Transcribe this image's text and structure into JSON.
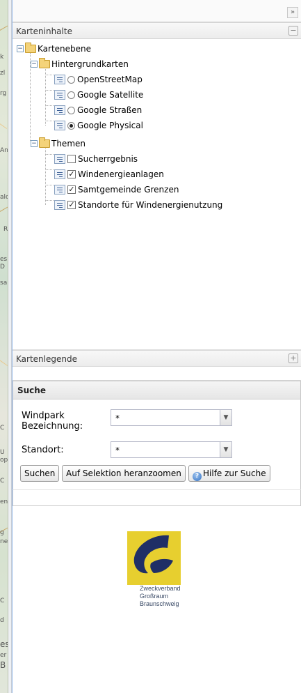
{
  "map_labels": [
    "k",
    "zl",
    "rg",
    "An",
    "alc",
    "R",
    "es",
    "D",
    "sa",
    "C",
    "U",
    "op",
    "C",
    "en",
    "g",
    "ne",
    "C",
    "d",
    "es",
    "er",
    "B"
  ],
  "topbar": {
    "collapse_glyph": "»"
  },
  "layers_panel": {
    "title": "Karteninhalte",
    "collapse_glyph": "−",
    "tree": {
      "root": "Kartenebene",
      "basemaps_group": "Hintergrundkarten",
      "basemaps": [
        {
          "label": "OpenStreetMap",
          "selected": false
        },
        {
          "label": "Google Satellite",
          "selected": false
        },
        {
          "label": "Google Straßen",
          "selected": false
        },
        {
          "label": "Google Physical",
          "selected": true
        }
      ],
      "themes_group": "Themen",
      "themes": [
        {
          "label": "Sucherrgebnis",
          "checked": false
        },
        {
          "label": "Windenergieanlagen",
          "checked": true
        },
        {
          "label": "Samtgemeinde Grenzen",
          "checked": true
        },
        {
          "label": "Standorte für Windenergienutzung",
          "checked": true
        }
      ]
    }
  },
  "legend_panel": {
    "title": "Kartenlegende",
    "expand_glyph": "+"
  },
  "search": {
    "title": "Suche",
    "windpark_label": "Windpark Bezeichnung:",
    "windpark_value": "*",
    "standort_label": "Standort:",
    "standort_value": "*",
    "buttons": {
      "search": "Suchen",
      "zoom": "Auf Selektion heranzoomen",
      "help": "Hilfe zur Suche"
    }
  },
  "logo": {
    "line1": "Zweckverband",
    "line2": "Großraum",
    "line3": "Braunschweig",
    "brand_yellow": "#e7cf2f",
    "brand_blue": "#1f2f66"
  }
}
